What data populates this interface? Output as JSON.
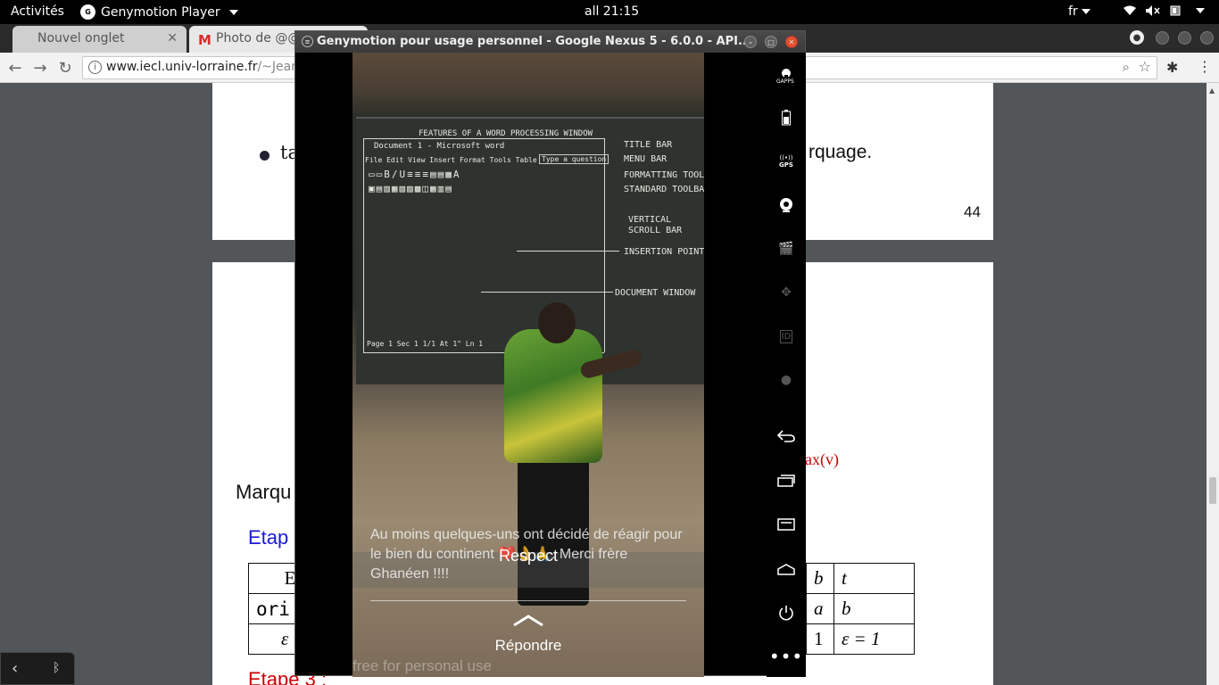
{
  "topbar": {
    "activities": "Activités",
    "app_name": "Genymotion Player",
    "app_icon": "geny-icon",
    "clock": "all 21:15",
    "language": "fr"
  },
  "browser": {
    "tabs": [
      {
        "label": "Nouvel onglet"
      },
      {
        "label": "Photo de @@"
      }
    ],
    "url_host": "www.iecl.univ-lorraine.fr",
    "url_path": "/~Jean-F"
  },
  "pdf": {
    "bullet_left": "ta",
    "bullet_right": "rquage.",
    "page_number": "44",
    "max_v": "ax(v)",
    "marque": "Marqu",
    "etape": "Etap",
    "etape3": "Etape 3 :",
    "table": {
      "rows": [
        {
          "c1": "E",
          "c2": "b",
          "c3": "t"
        },
        {
          "c1": "ori",
          "c2": "a",
          "c3": "b"
        },
        {
          "c1": "ε",
          "c2": "1",
          "c3": "ε = 1"
        }
      ]
    }
  },
  "genymotion": {
    "title": "Genymotion pour usage personnel - Google Nexus 5 - 6.0.0 - API...",
    "side_tools": [
      "gapps-icon",
      "battery-icon",
      "gps-icon",
      "camera-icon",
      "media-icon",
      "remote-control-icon",
      "device-id-icon",
      "disk-icon",
      "back-icon",
      "recent-apps-icon",
      "menu-icon",
      "home-icon",
      "power-icon",
      "more-icon"
    ],
    "gapps_label": "GAPPS",
    "gps_label": "GPS",
    "id_label": "ID"
  },
  "phone": {
    "chalkboard": {
      "heading": "FEATURES OF A WORD PROCESSING WINDOW",
      "labels": [
        "TITLE BAR",
        "MENU BAR",
        "FORMATTING TOOLB",
        "STANDARD TOOLBA",
        "VERTICAL",
        "SCROLL BAR",
        "INSERTION POINT",
        "DOCUMENT WINDOW"
      ],
      "doc_title": "Document 1 - Microsoft word",
      "menu_items": "File  Edit  View  Insert  Format  Tools  Table",
      "help_box": "Type a question",
      "status": "Page 1  Sec 1   1/1  At 1\"  Ln 1"
    },
    "comment": "Au moins quelques-uns ont décidé de réagir pour le bien du continent ❤️👌🙏. Merci frère Ghanéen !!!!",
    "respect": "Respect",
    "reply": "Répondre",
    "watermark": "free for personal use"
  }
}
